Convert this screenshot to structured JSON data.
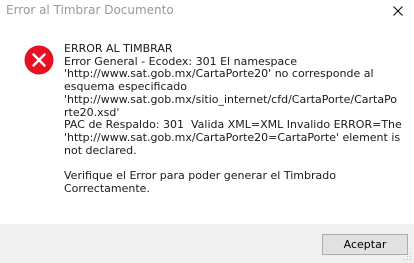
{
  "window": {
    "title": "Error al Timbrar Documento",
    "accent_close": "#e81123"
  },
  "message": {
    "lines": [
      "ERROR AL TIMBRAR",
      "Error General - Ecodex: 301 El namespace",
      "'http://www.sat.gob.mx/CartaPorte20' no corresponde al",
      "esquema especificado",
      "'http://www.sat.gob.mx/sitio_internet/cfd/CartaPorte/CartaPo",
      "rte20.xsd'",
      "PAC de Respaldo: 301  Valida XML=XML Invalido ERROR=The",
      "'http://www.sat.gob.mx/CartaPorte20=CartaPorte' element is",
      "not declared.",
      "",
      "Verifique el Error para poder generar el Timbrado",
      "Correctamente."
    ]
  },
  "icons": {
    "status": "error-icon",
    "status_color": "#e81123"
  },
  "footer": {
    "accept_label": "Aceptar"
  }
}
